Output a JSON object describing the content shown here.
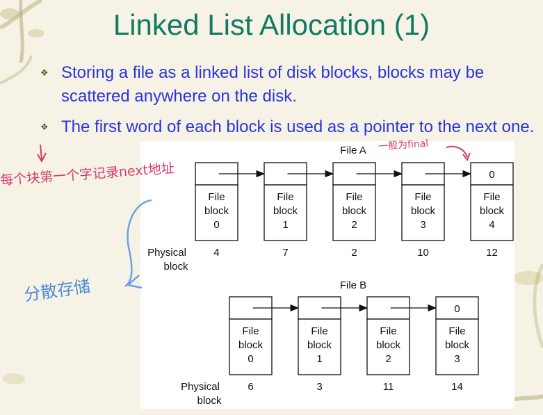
{
  "slide": {
    "title": "Linked List Allocation (1)",
    "bullets": [
      {
        "text": "Storing a file as a linked list of disk blocks, blocks may be scattered anywhere on the disk."
      },
      {
        "text": "The first word of each block is used as a pointer to the next one."
      }
    ]
  },
  "diagram": {
    "block_word": "File",
    "block_word2": "block",
    "row_label_line1": "Physical",
    "row_label_line2": "block",
    "files": [
      {
        "name": "File A",
        "blocks": [
          {
            "index": "0",
            "physical": "4",
            "pointer": ""
          },
          {
            "index": "1",
            "physical": "7",
            "pointer": ""
          },
          {
            "index": "2",
            "physical": "2",
            "pointer": ""
          },
          {
            "index": "3",
            "physical": "10",
            "pointer": ""
          },
          {
            "index": "4",
            "physical": "12",
            "pointer": "0"
          }
        ]
      },
      {
        "name": "File B",
        "blocks": [
          {
            "index": "0",
            "physical": "6",
            "pointer": ""
          },
          {
            "index": "1",
            "physical": "3",
            "pointer": ""
          },
          {
            "index": "2",
            "physical": "11",
            "pointer": ""
          },
          {
            "index": "3",
            "physical": "14",
            "pointer": "0"
          }
        ]
      }
    ]
  },
  "annotations": {
    "left_note": "每个块第一个字记录next地址",
    "final_note": "一般为final",
    "scatter_note": "分散存储"
  },
  "colors": {
    "title": "#127a63",
    "bullet_text": "#2b35d9",
    "handwriting_red": "#d23b6a",
    "handwriting_blue": "#4a8bd8"
  }
}
